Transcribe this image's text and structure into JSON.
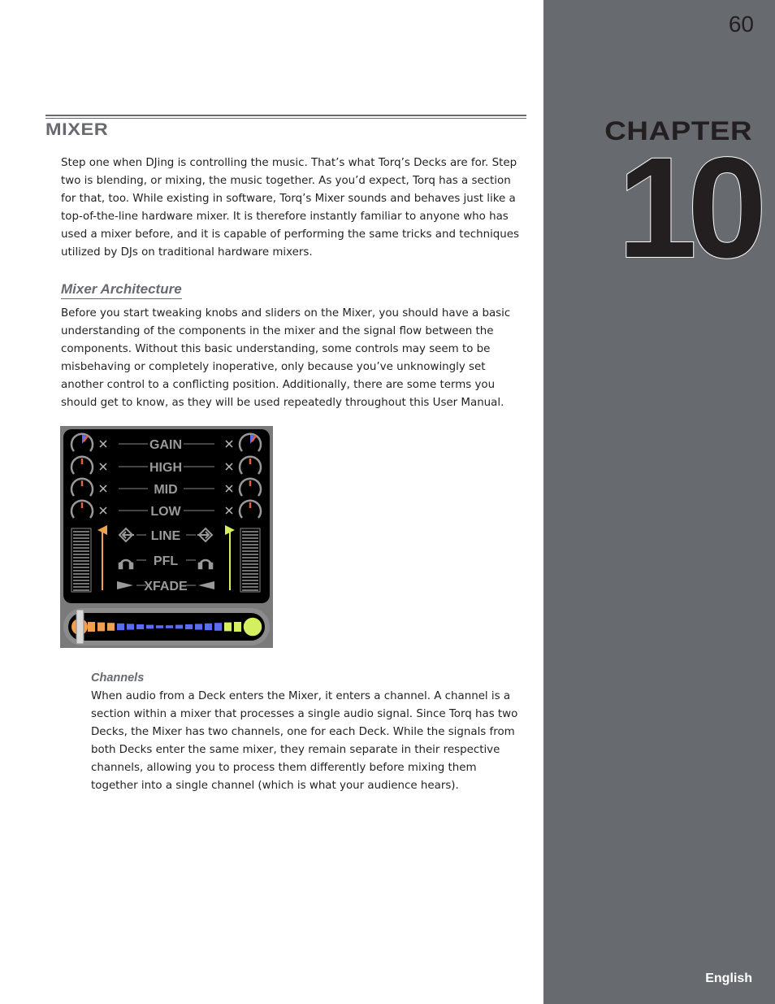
{
  "sidebar": {
    "page_number": "60",
    "chapter_label": "CHAPTER",
    "chapter_number": "10",
    "footer_language": "English",
    "background_color": "#676a6f"
  },
  "section": {
    "title": "MIXER",
    "intro_paragraph": "Step one when DJing is controlling the music. That’s what Torq’s Decks are for. Step two is blending, or mixing, the music together. As you’d expect, Torq has a section for that, too. While existing in software, Torq’s Mixer sounds and behaves just like a top-of-the-line hardware mixer. It is therefore instantly familiar to anyone who has used a mixer before, and it is capable of performing the same tricks and techniques utilized by DJs on traditional hardware mixers."
  },
  "subsection": {
    "title": "Mixer Architecture",
    "paragraph": "Before you start tweaking knobs and sliders on the Mixer, you should have a basic understanding of the components in the mixer and the signal flow between the components. Without this basic understanding, some controls may seem to be misbehaving or completely inoperative, only because you’ve unknowingly set another control to a conflicting position. Additionally, there are some terms you should get to know, as they will be used repeatedly throughout this User Manual."
  },
  "mixer_figure": {
    "rows": [
      "GAIN",
      "HIGH",
      "MID",
      "LOW",
      "LINE",
      "PFL",
      "XFADE"
    ],
    "left_deck_color": "#f0a050",
    "right_deck_color": "#d4f060",
    "crossfader_center_color": "#5a6cf0"
  },
  "channels": {
    "title": "Channels",
    "paragraph": "When audio from a Deck enters the Mixer, it enters a channel. A channel is a section within a mixer that processes a single audio signal. Since Torq has two Decks, the Mixer has two channels, one for each Deck. While the signals from both Decks enter the same mixer, they remain separate in their respective channels, allowing you to process them differently before mixing them together into a single channel (which is what your audience hears)."
  }
}
